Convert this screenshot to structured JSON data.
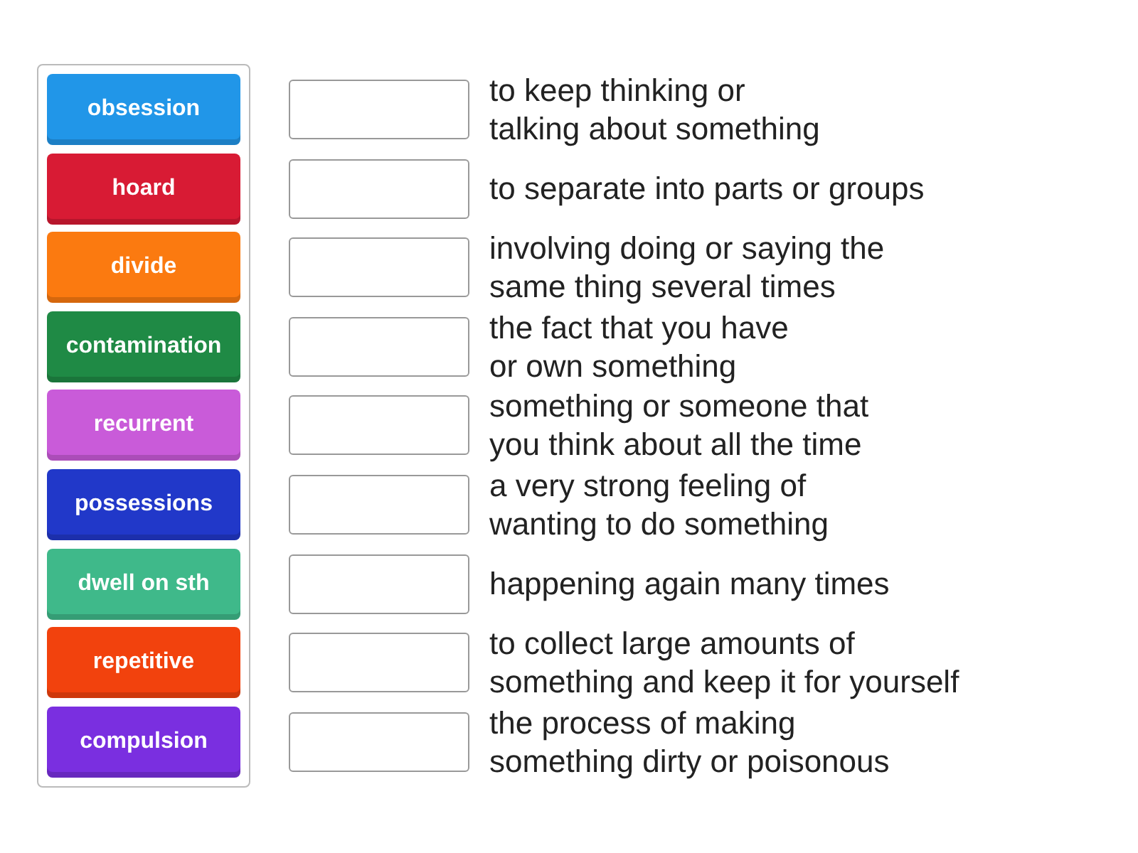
{
  "tiles": [
    {
      "label": "obsession",
      "color": "#2196e8"
    },
    {
      "label": "hoard",
      "color": "#d81b34"
    },
    {
      "label": "divide",
      "color": "#fb7a10"
    },
    {
      "label": "contamination",
      "color": "#1f8a45"
    },
    {
      "label": "recurrent",
      "color": "#c95bd9"
    },
    {
      "label": "possessions",
      "color": "#2138c9"
    },
    {
      "label": "dwell on sth",
      "color": "#3fb98a"
    },
    {
      "label": "repetitive",
      "color": "#f2420d"
    },
    {
      "label": "compulsion",
      "color": "#7a2fe0"
    }
  ],
  "definitions": [
    "to keep thinking or\ntalking about something",
    "to separate into parts or groups",
    "involving doing or saying the\nsame thing several times",
    "the fact that you have\nor own something",
    "something or someone that\nyou think about all the time",
    "a very strong feeling of\nwanting to do something",
    "happening again many times",
    "to collect large amounts of\nsomething and keep it for yourself",
    "the process of making\nsomething dirty or poisonous"
  ]
}
